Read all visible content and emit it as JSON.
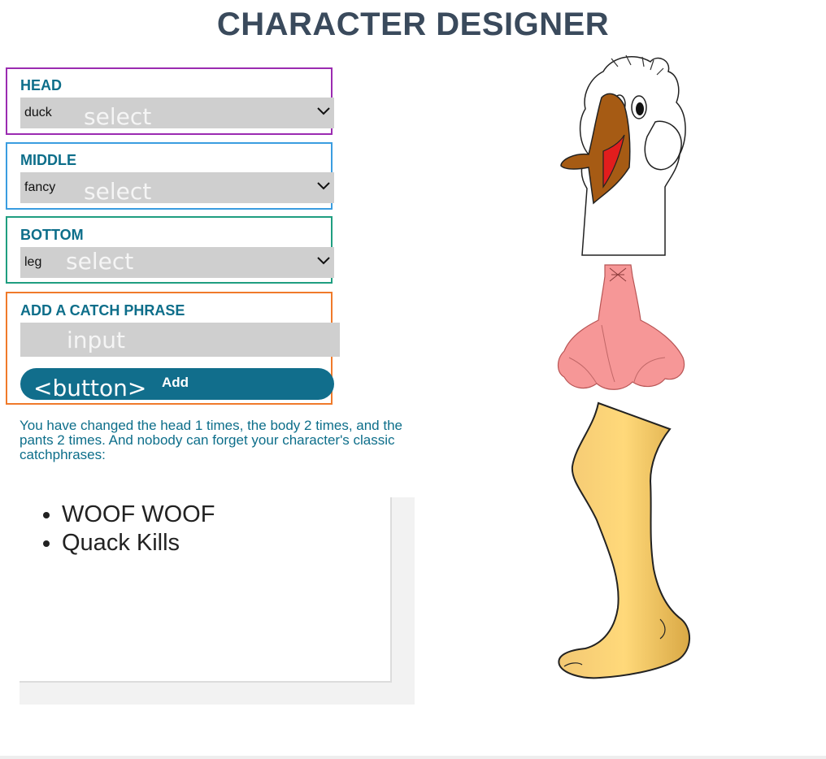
{
  "page_title": "CHARACTER DESIGNER",
  "head": {
    "label": "HEAD",
    "value": "duck",
    "overlay": "select"
  },
  "middle": {
    "label": "MIDDLE",
    "value": "fancy",
    "overlay": "select"
  },
  "bottom": {
    "label": "BOTTOM",
    "value": "leg",
    "overlay": "select"
  },
  "phrase": {
    "label": "ADD A CATCH PHRASE",
    "input_overlay": "input",
    "button_overlay": "<button>",
    "button_label": "Add"
  },
  "summary": "You have changed the head 1 times, the body 2 times, and the pants 2 times. And nobody can forget your character's classic catchphrases:",
  "catchphrases": [
    "WOOF WOOF",
    "Quack Kills"
  ],
  "colors": {
    "accent": "#116e8c",
    "label": "#0d6e8a",
    "head_border": "#9b2bb1",
    "middle_border": "#3a9de0",
    "bottom_border": "#1f9e80",
    "phrase_border": "#f07a2a"
  }
}
